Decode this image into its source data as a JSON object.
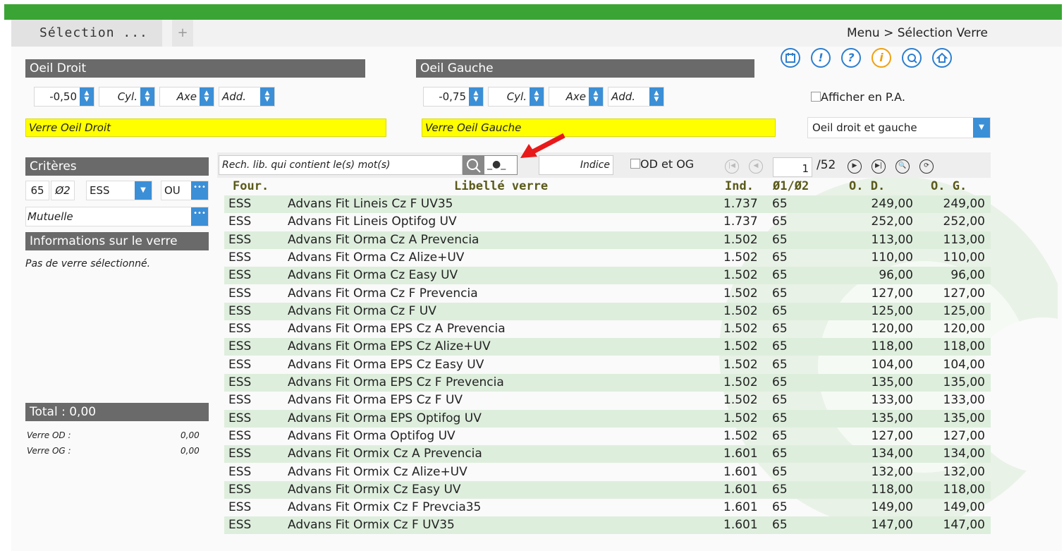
{
  "tabs": {
    "active": "Sélection ...",
    "add": "+"
  },
  "breadcrumb": "Menu > Sélection Verre",
  "oeil_droit": {
    "title": "Oeil Droit",
    "sphere": "-0,50",
    "cyl_placeholder": "Cyl.",
    "axe_placeholder": "Axe",
    "add_placeholder": "Add.",
    "verre": "Verre Oeil Droit"
  },
  "oeil_gauche": {
    "title": "Oeil Gauche",
    "sphere": "-0,75",
    "cyl_placeholder": "Cyl.",
    "axe_placeholder": "Axe",
    "add_placeholder": "Add.",
    "verre": "Verre Oeil Gauche"
  },
  "options": {
    "afficher_pa": "Afficher en P.A.",
    "eye_select": "Oeil droit et gauche"
  },
  "criteres": {
    "title": "Critères",
    "diameter": "65",
    "diameter_label": "Ø2",
    "supplier": "ESS",
    "ou": "OU",
    "mutuelle": "Mutuelle"
  },
  "info": {
    "title": "Informations sur le verre",
    "none": "Pas de verre sélectionné."
  },
  "total": {
    "title": "Total : 0,00",
    "verre_od_label": "Verre OD :",
    "verre_od_value": "0,00",
    "verre_og_label": "Verre OG :",
    "verre_og_value": "0,00"
  },
  "search": {
    "placeholder": "Rech. lib. qui contient le(s) mot(s)",
    "indice_placeholder": "Indice",
    "od_og": "OD et OG",
    "page": "1",
    "pages_total": "/52"
  },
  "table": {
    "headers": {
      "four": "Four.",
      "lib": "Libellé verre",
      "ind": "Ind.",
      "dia": "Ø1/Ø2",
      "od": "O. D.",
      "og": "O. G."
    },
    "rows": [
      {
        "four": "ESS",
        "lib": "Advans Fit Lineis Cz F UV35",
        "ind": "1.737",
        "dia": "65",
        "od": "249,00",
        "og": "249,00"
      },
      {
        "four": "ESS",
        "lib": "Advans Fit Lineis Optifog UV",
        "ind": "1.737",
        "dia": "65",
        "od": "252,00",
        "og": "252,00"
      },
      {
        "four": "ESS",
        "lib": "Advans Fit Orma Cz A Prevencia",
        "ind": "1.502",
        "dia": "65",
        "od": "113,00",
        "og": "113,00"
      },
      {
        "four": "ESS",
        "lib": "Advans Fit Orma Cz Alize+UV",
        "ind": "1.502",
        "dia": "65",
        "od": "110,00",
        "og": "110,00"
      },
      {
        "four": "ESS",
        "lib": "Advans Fit Orma Cz Easy UV",
        "ind": "1.502",
        "dia": "65",
        "od": "96,00",
        "og": "96,00"
      },
      {
        "four": "ESS",
        "lib": "Advans Fit Orma Cz F Prevencia",
        "ind": "1.502",
        "dia": "65",
        "od": "127,00",
        "og": "127,00"
      },
      {
        "four": "ESS",
        "lib": "Advans Fit Orma Cz F UV",
        "ind": "1.502",
        "dia": "65",
        "od": "125,00",
        "og": "125,00"
      },
      {
        "four": "ESS",
        "lib": "Advans Fit Orma EPS Cz A Prevencia",
        "ind": "1.502",
        "dia": "65",
        "od": "120,00",
        "og": "120,00"
      },
      {
        "four": "ESS",
        "lib": "Advans Fit Orma EPS Cz Alize+UV",
        "ind": "1.502",
        "dia": "65",
        "od": "118,00",
        "og": "118,00"
      },
      {
        "four": "ESS",
        "lib": "Advans Fit Orma EPS Cz Easy UV",
        "ind": "1.502",
        "dia": "65",
        "od": "104,00",
        "og": "104,00"
      },
      {
        "four": "ESS",
        "lib": "Advans Fit Orma EPS Cz F Prevencia",
        "ind": "1.502",
        "dia": "65",
        "od": "135,00",
        "og": "135,00"
      },
      {
        "four": "ESS",
        "lib": "Advans Fit Orma EPS Cz F UV",
        "ind": "1.502",
        "dia": "65",
        "od": "133,00",
        "og": "133,00"
      },
      {
        "four": "ESS",
        "lib": "Advans Fit Orma EPS Optifog UV",
        "ind": "1.502",
        "dia": "65",
        "od": "135,00",
        "og": "135,00"
      },
      {
        "four": "ESS",
        "lib": "Advans Fit Orma Optifog UV",
        "ind": "1.502",
        "dia": "65",
        "od": "127,00",
        "og": "127,00"
      },
      {
        "four": "ESS",
        "lib": "Advans Fit Ormix Cz A Prevencia",
        "ind": "1.601",
        "dia": "65",
        "od": "134,00",
        "og": "134,00"
      },
      {
        "four": "ESS",
        "lib": "Advans Fit Ormix Cz Alize+UV",
        "ind": "1.601",
        "dia": "65",
        "od": "132,00",
        "og": "132,00"
      },
      {
        "four": "ESS",
        "lib": "Advans Fit Ormix Cz Easy UV",
        "ind": "1.601",
        "dia": "65",
        "od": "118,00",
        "og": "118,00"
      },
      {
        "four": "ESS",
        "lib": "Advans Fit Ormix Cz F Prevcia35",
        "ind": "1.601",
        "dia": "65",
        "od": "149,00",
        "og": "149,00"
      },
      {
        "four": "ESS",
        "lib": "Advans Fit Ormix Cz F UV35",
        "ind": "1.601",
        "dia": "65",
        "od": "147,00",
        "og": "147,00"
      }
    ]
  },
  "colors": {
    "accent": "#3aa534",
    "button": "#3b8fd6",
    "header": "#6a6a6a",
    "highlight": "#ffff00",
    "row_alt": "#deeedd"
  },
  "icons": [
    "calendar-icon",
    "alert-icon",
    "help-icon",
    "info-icon",
    "settings-icon",
    "home-icon"
  ]
}
